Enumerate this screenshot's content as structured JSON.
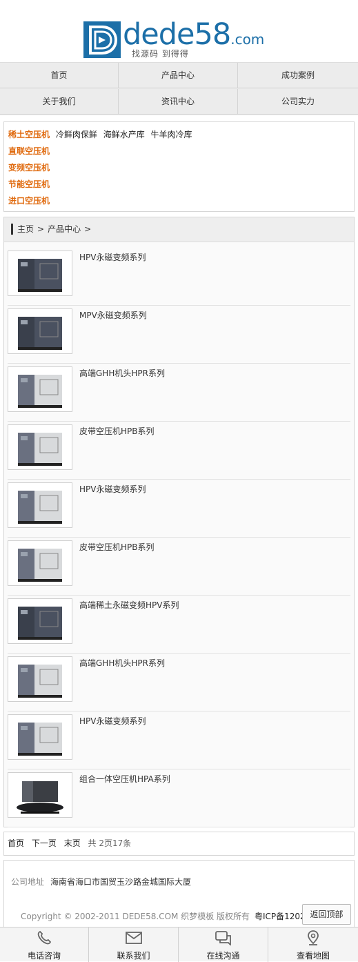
{
  "logo": {
    "word": "dede58",
    "domain": ".com",
    "slogan": "找源码 到得得"
  },
  "nav": {
    "items": [
      "首页",
      "产品中心",
      "成功案例",
      "关于我们",
      "资讯中心",
      "公司实力"
    ]
  },
  "categories": {
    "rows": [
      {
        "main": "稀土空压机",
        "subs": [
          "冷鲜肉保鲜",
          "海鲜水产库",
          "牛羊肉冷库"
        ]
      },
      {
        "main": "直联空压机",
        "subs": []
      },
      {
        "main": "变频空压机",
        "subs": []
      },
      {
        "main": "节能空压机",
        "subs": []
      },
      {
        "main": "进口空压机",
        "subs": []
      }
    ]
  },
  "breadcrumb": {
    "home": "主页",
    "sep1": ">",
    "section": "产品中心",
    "sep2": ">"
  },
  "products": [
    {
      "title": "HPV永磁变频系列",
      "style": "dark"
    },
    {
      "title": "MPV永磁变频系列",
      "style": "dark"
    },
    {
      "title": "高端GHH机头HPR系列",
      "style": "light"
    },
    {
      "title": "皮带空压机HPB系列",
      "style": "light"
    },
    {
      "title": "HPV永磁变频系列",
      "style": "light"
    },
    {
      "title": "皮带空压机HPB系列",
      "style": "light"
    },
    {
      "title": "高端稀土永磁变频HPV系列",
      "style": "dark"
    },
    {
      "title": "高端GHH机头HPR系列",
      "style": "light"
    },
    {
      "title": "HPV永磁变频系列",
      "style": "light"
    },
    {
      "title": "组合一体空压机HPA系列",
      "style": "tank"
    }
  ],
  "pager": {
    "first": "首页",
    "next": "下一页",
    "last": "末页",
    "info": "共 2页17条"
  },
  "footer": {
    "address_label": "公司地址",
    "address": "海南省海口市国贸玉沙路金城国际大厦",
    "copyright": "Copyright © 2002-2011 DEDE58.COM 织梦模板 版权所有",
    "icp": "粤ICP备1202",
    "back_top": "返回顶部"
  },
  "bottombar": {
    "items": [
      {
        "label": "电话咨询",
        "icon": "phone-icon"
      },
      {
        "label": "联系我们",
        "icon": "mail-icon"
      },
      {
        "label": "在线沟通",
        "icon": "chat-icon"
      },
      {
        "label": "查看地图",
        "icon": "map-pin-icon"
      }
    ]
  },
  "colors": {
    "brand": "#1c6fa8",
    "category": "#e06b10"
  }
}
